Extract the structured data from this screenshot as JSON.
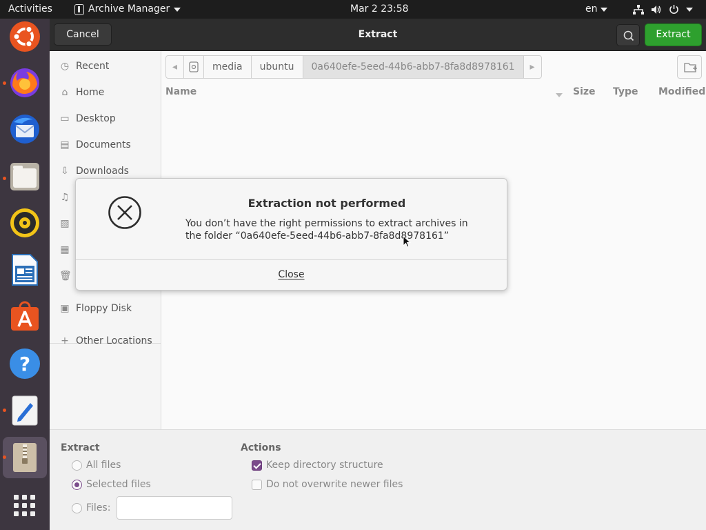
{
  "topbar": {
    "activities": "Activities",
    "app_name": "Archive Manager",
    "clock": "Mar 2  23:58",
    "language": "en",
    "icons": [
      "network-icon",
      "volume-icon",
      "power-icon"
    ]
  },
  "dock": {
    "items": [
      "ubuntu-logo-icon",
      "firefox-icon",
      "thunderbird-icon",
      "files-icon",
      "rhythmbox-icon",
      "libreoffice-writer-icon",
      "software-center-icon",
      "help-icon",
      "text-editor-icon",
      "archive-manager-icon",
      "show-apps-icon"
    ]
  },
  "header": {
    "cancel": "Cancel",
    "title": "Extract",
    "extract": "Extract"
  },
  "sidebar": {
    "items": [
      {
        "label": "Recent",
        "icon": "clock-icon"
      },
      {
        "label": "Home",
        "icon": "home-icon"
      },
      {
        "label": "Desktop",
        "icon": "desktop-icon"
      },
      {
        "label": "Documents",
        "icon": "documents-icon"
      },
      {
        "label": "Downloads",
        "icon": "downloads-icon"
      },
      {
        "label": "",
        "icon": "music-icon"
      },
      {
        "label": "",
        "icon": "pictures-icon"
      },
      {
        "label": "",
        "icon": "videos-icon"
      },
      {
        "label": "",
        "icon": "trash-icon"
      },
      {
        "label": "Floppy Disk",
        "icon": "floppy-icon"
      },
      {
        "label": "Other Locations",
        "icon": "plus-icon"
      }
    ]
  },
  "pathbar": {
    "segments": [
      "media",
      "ubuntu",
      "0a640efe-5eed-44b6-abb7-8fa8d8978161"
    ]
  },
  "columns": {
    "name": "Name",
    "size": "Size",
    "type": "Type",
    "modified": "Modified"
  },
  "options": {
    "extract_title": "Extract",
    "all_files": "All files",
    "selected_files": "Selected files",
    "files": "Files:",
    "files_value": "",
    "actions_title": "Actions",
    "keep_structure": "Keep directory structure",
    "no_overwrite": "Do not overwrite newer files"
  },
  "dialog": {
    "title": "Extraction not performed",
    "message": "You don’t have the right permissions to extract archives in the folder “0a640efe-5eed-44b6-abb7-8fa8d8978161”",
    "close": "Close"
  },
  "colors": {
    "accent_green": "#2ea02e",
    "ubuntu_orange": "#e95420",
    "check_purple": "#7a4a8a"
  }
}
